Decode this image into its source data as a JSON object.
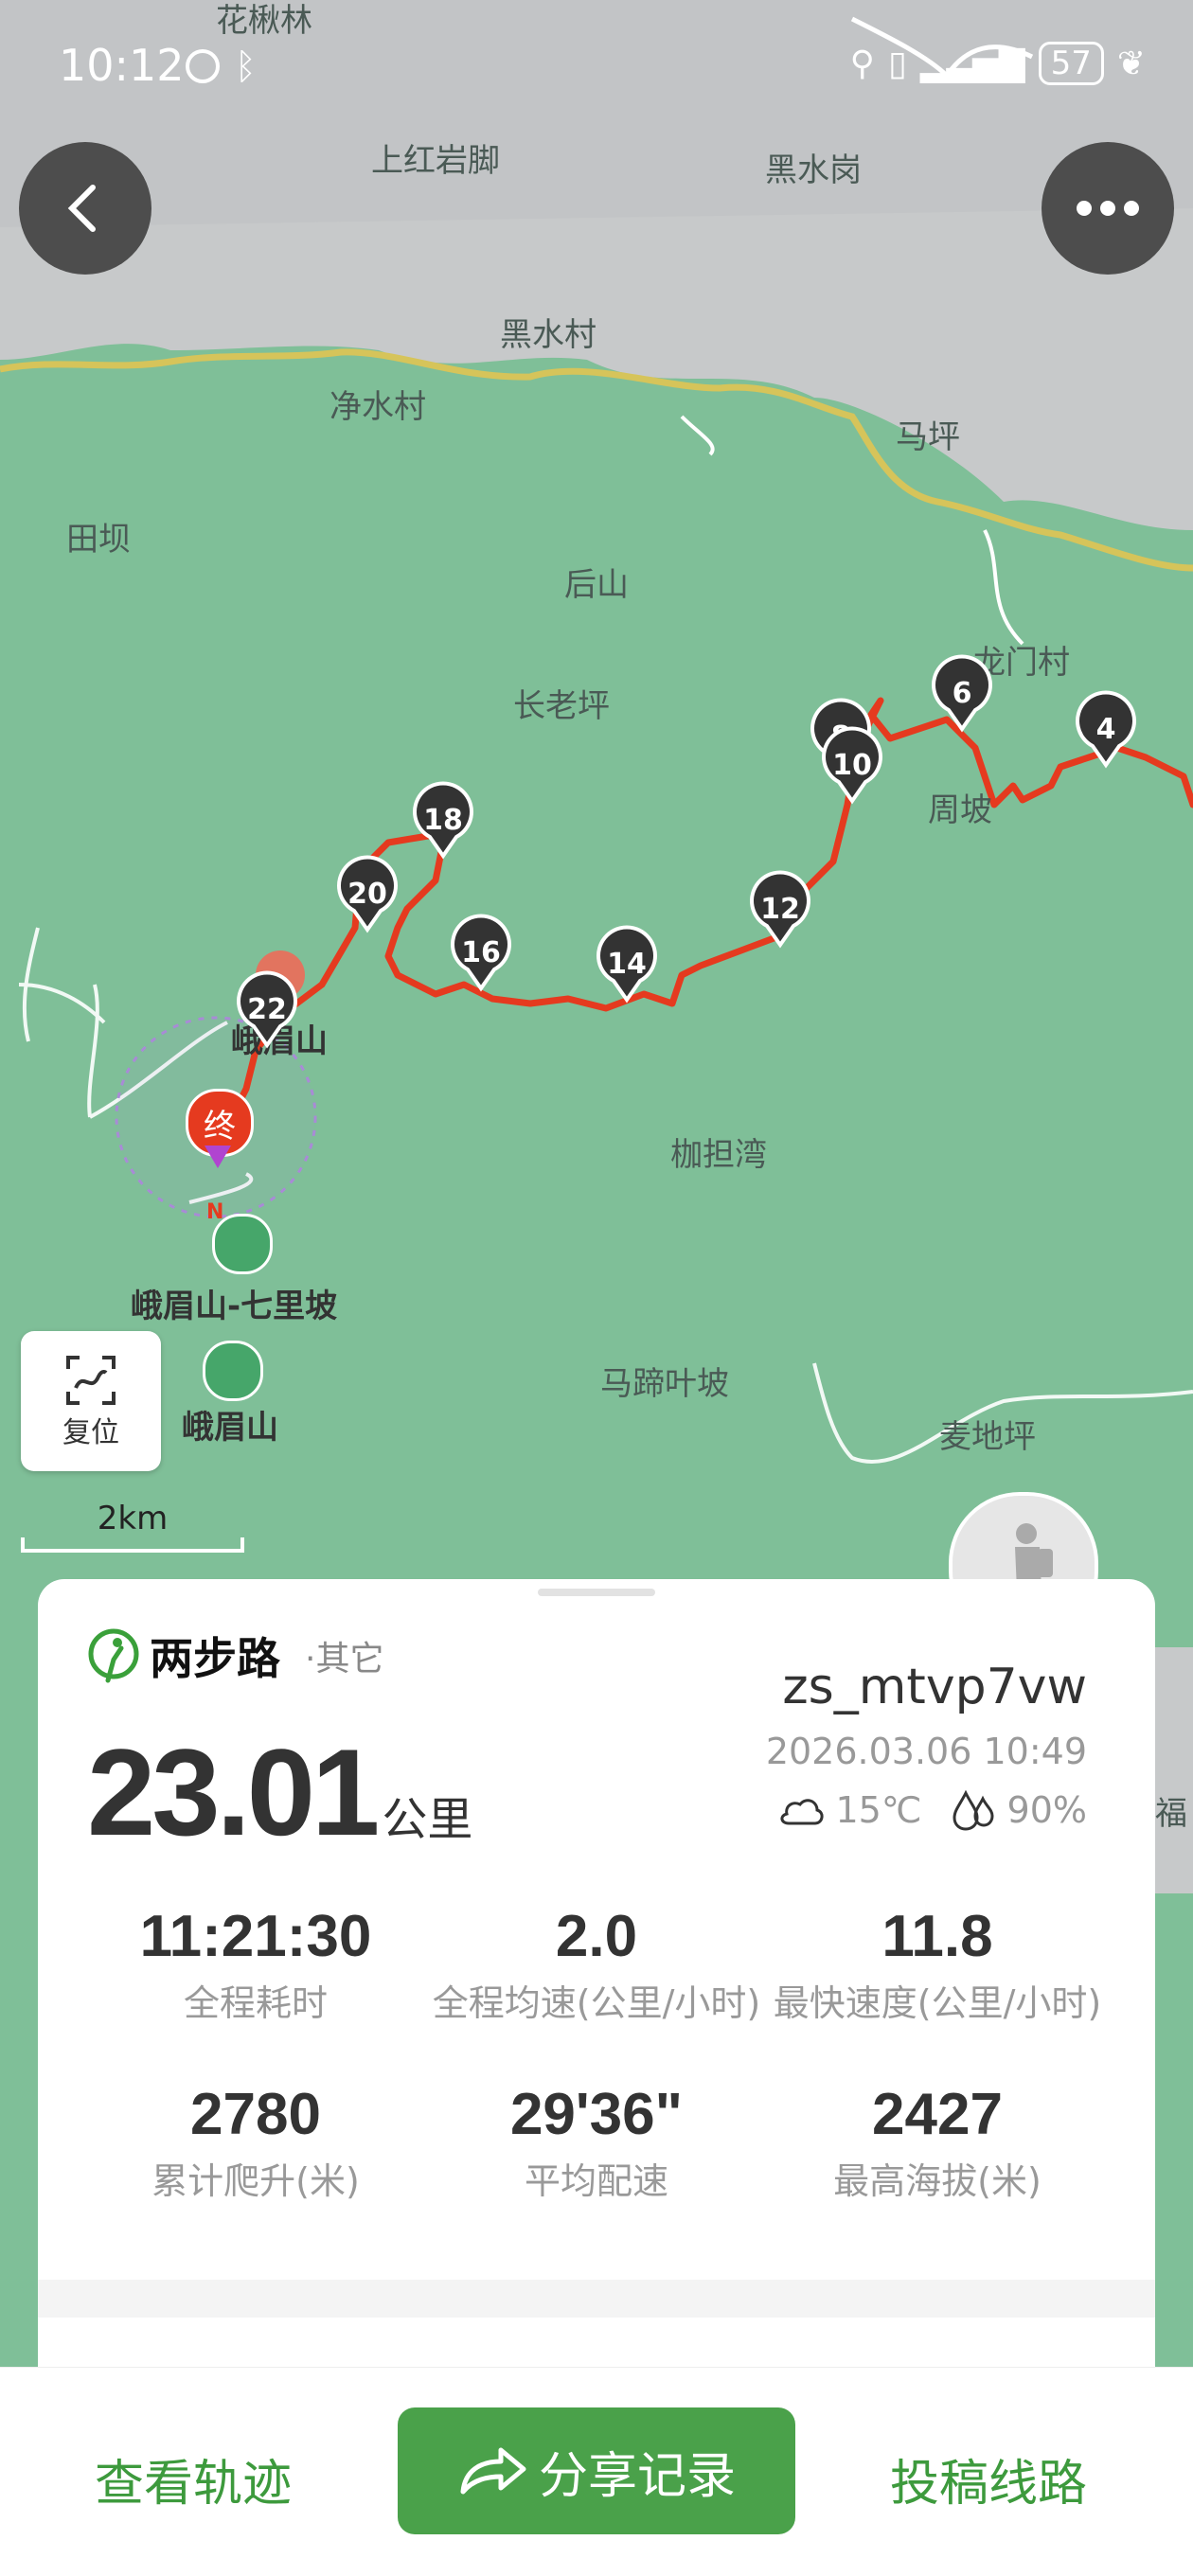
{
  "status_bar": {
    "time": "10:12",
    "battery": "57"
  },
  "map": {
    "places": [
      {
        "id": "huajiaolin",
        "label": "花楸林"
      },
      {
        "id": "shanghongyanjiao",
        "label": "上红岩脚"
      },
      {
        "id": "heishuigang",
        "label": "黑水岗"
      },
      {
        "id": "heishuicun",
        "label": "黑水村"
      },
      {
        "id": "jingshuicun",
        "label": "净水村"
      },
      {
        "id": "maping",
        "label": "马坪"
      },
      {
        "id": "tianba",
        "label": "田坝"
      },
      {
        "id": "houshan",
        "label": "后山"
      },
      {
        "id": "changlaoping",
        "label": "长老坪"
      },
      {
        "id": "longmencun",
        "label": "龙门村"
      },
      {
        "id": "zhoupo",
        "label": "周坡"
      },
      {
        "id": "emeishan_peak",
        "label": "峨眉山"
      },
      {
        "id": "jiadanwan",
        "label": "枷担湾"
      },
      {
        "id": "emeishan_qilipo",
        "label": "峨眉山-七里坡"
      },
      {
        "id": "matiyepo",
        "label": "马蹄叶坡"
      },
      {
        "id": "emeishan",
        "label": "峨眉山"
      },
      {
        "id": "maidiping",
        "label": "麦地坪"
      },
      {
        "id": "fu",
        "label": "福"
      }
    ],
    "markers": [
      "4",
      "6",
      "8",
      "10",
      "12",
      "14",
      "16",
      "18",
      "20",
      "22"
    ],
    "end_marker": "终",
    "north_label": "N",
    "reset_label": "复位",
    "scale_label": "2km",
    "colors": {
      "route": "#e53a1f",
      "land": "#7fbf98",
      "boundary": "#d6c45a",
      "marker": "#333333"
    }
  },
  "card": {
    "brand": "两步路",
    "activity_type": "·其它",
    "distance": "23.01",
    "distance_unit": "公里",
    "username": "zs_mtvp7vw",
    "datetime": "2026.03.06 10:49",
    "temperature": "15℃",
    "humidity": "90%",
    "stats": [
      {
        "value": "11:21:30",
        "label": "全程耗时"
      },
      {
        "value": "2.0",
        "label": "全程均速(公里/小时)"
      },
      {
        "value": "11.8",
        "label": "最快速度(公里/小时)"
      },
      {
        "value": "2780",
        "label": "累计爬升(米)"
      },
      {
        "value": "29'36\"",
        "label": "平均配速"
      },
      {
        "value": "2427",
        "label": "最高海拔(米)"
      }
    ]
  },
  "bottom_bar": {
    "view_track": "查看轨迹",
    "share": "分享记录",
    "submit_route": "投稿线路"
  }
}
